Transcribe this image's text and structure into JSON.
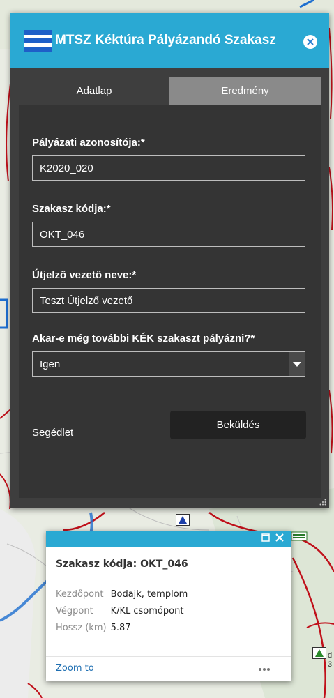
{
  "panel": {
    "title": "MTSZ Kéktúra Pályázandó Szakasz",
    "tabs": [
      {
        "label": "Adatlap",
        "active": true
      },
      {
        "label": "Eredmény",
        "active": false
      }
    ],
    "fields": [
      {
        "label": "Pályázati azonosítója:*",
        "value": "K2020_020"
      },
      {
        "label": "Szakasz kódja:*",
        "value": "OKT_046"
      },
      {
        "label": "Útjelző vezető neve:*",
        "value": "Teszt Útjelző vezető"
      }
    ],
    "select": {
      "label": "Akar-e még további KÉK szakaszt pályázni?*",
      "value": "Igen"
    },
    "help_link": "Segédlet",
    "submit_label": "Beküldés"
  },
  "popup": {
    "title": "Szakasz kódja: OKT_046",
    "attributes": [
      {
        "key": "Kezdőpont",
        "value": "Bodajk, templom"
      },
      {
        "key": "Végpont",
        "value": "K/KL csomópont"
      },
      {
        "key": "Hossz (km)",
        "value": "5.87"
      }
    ],
    "zoom_link": "Zoom to"
  },
  "map": {
    "labels": [
      "d",
      "3"
    ]
  },
  "colors": {
    "header": "#2aa9d3",
    "panel_bg": "#3e3e3e",
    "form_bg": "#343434",
    "route_red": "#c0101a",
    "route_blue": "#1e6fd0",
    "map_bg": "#e9ece3"
  },
  "icons": [
    "flag-icon",
    "close-circle-icon",
    "dropdown-arrow-icon",
    "resize-grip-icon",
    "maximize-icon",
    "close-icon",
    "more-dots-icon",
    "triangle-marker-icon"
  ]
}
